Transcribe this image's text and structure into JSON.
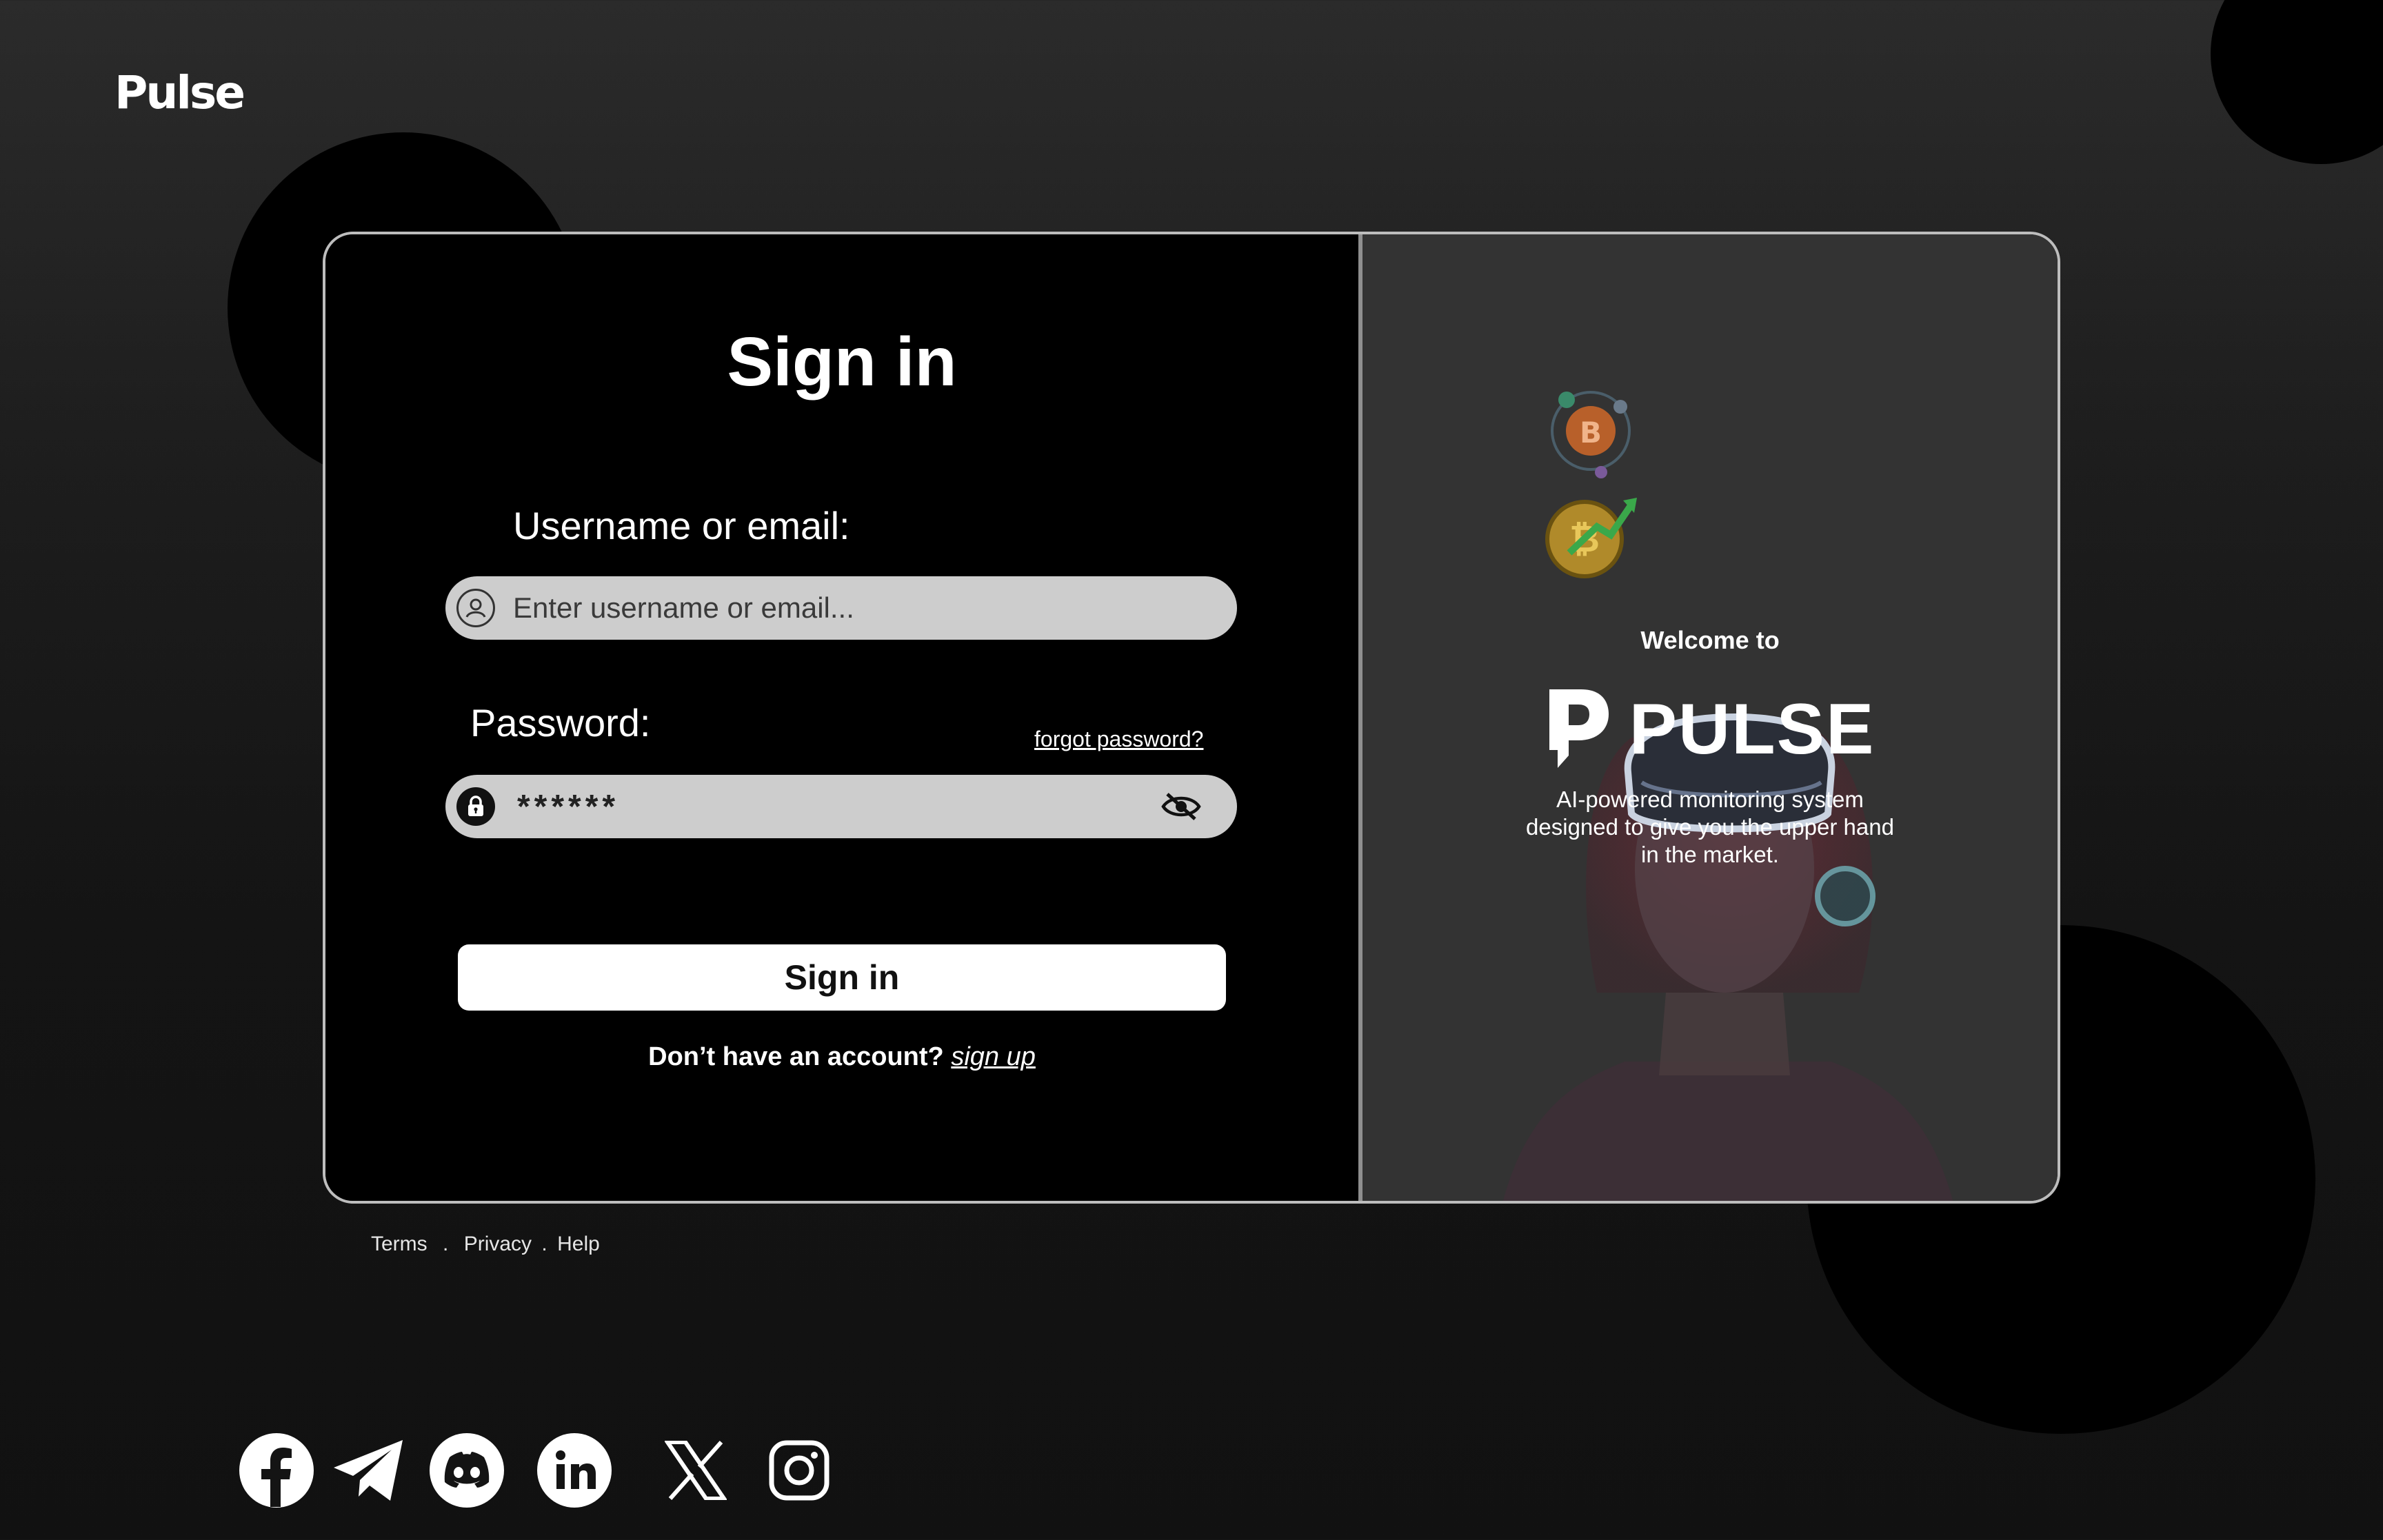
{
  "app": {
    "logo_text": "Pulse"
  },
  "signin": {
    "title": "Sign in",
    "username_label": "Username or email:",
    "username_placeholder": "Enter username or email...",
    "password_label": "Password:",
    "forgot_link": "forgot password?",
    "password_masked": "******",
    "submit_label": "Sign in",
    "signup_prompt": "Don’t have an account?",
    "signup_link": " sign up"
  },
  "promo": {
    "welcome": "Welcome to",
    "brand": "PULSE",
    "tagline": "AI-powered monitoring system designed to give you the upper hand in the market."
  },
  "footer": {
    "terms": "Terms",
    "sep1": ".",
    "privacy": "Privacy",
    "sep2": ".",
    "help": "Help"
  },
  "socials": [
    "facebook-icon",
    "telegram-icon",
    "discord-icon",
    "linkedin-icon",
    "x-icon",
    "instagram-icon"
  ],
  "colors": {
    "background": "#141414",
    "card_left": "#000000",
    "card_right": "#333333",
    "input_fill": "#cdcdcd",
    "button": "#ffffff"
  }
}
